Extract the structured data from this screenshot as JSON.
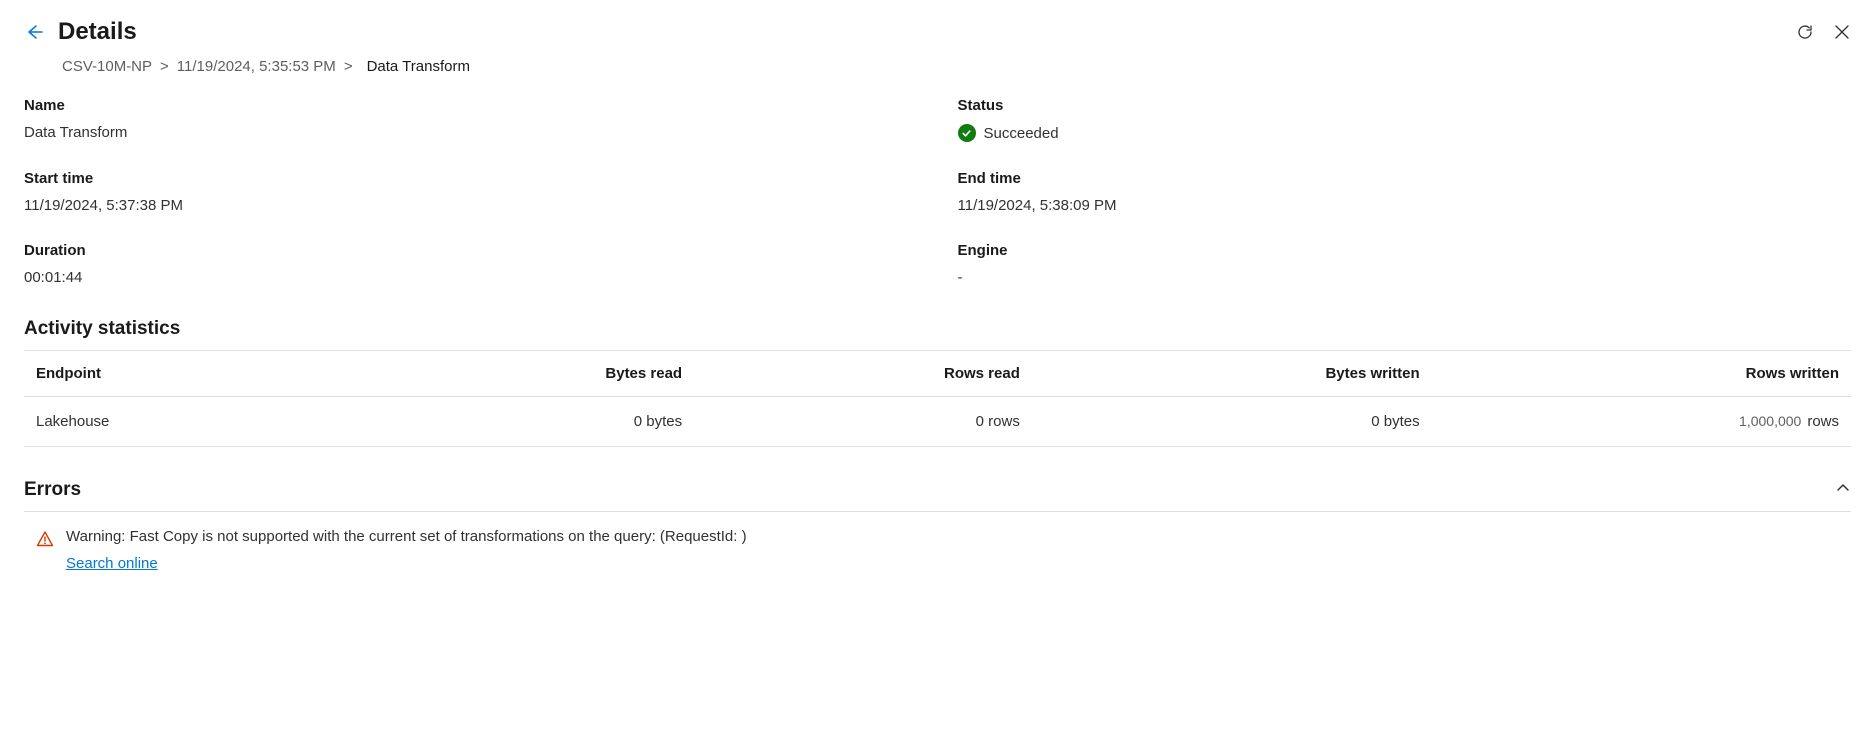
{
  "header": {
    "title": "Details"
  },
  "breadcrumb": {
    "parent": "CSV-10M-NP",
    "timestamp": "11/19/2024, 5:35:53 PM",
    "current": "Data Transform"
  },
  "fields": {
    "name_label": "Name",
    "name_value": "Data Transform",
    "status_label": "Status",
    "status_value": "Succeeded",
    "start_label": "Start time",
    "start_value": "11/19/2024, 5:37:38 PM",
    "end_label": "End time",
    "end_value": "11/19/2024, 5:38:09 PM",
    "duration_label": "Duration",
    "duration_value": "00:01:44",
    "engine_label": "Engine",
    "engine_value": "-"
  },
  "activity": {
    "title": "Activity statistics",
    "headers": {
      "endpoint": "Endpoint",
      "bytes_read": "Bytes read",
      "rows_read": "Rows read",
      "bytes_written": "Bytes written",
      "rows_written": "Rows written"
    },
    "rows": [
      {
        "endpoint": "Lakehouse",
        "bytes_read": "0 bytes",
        "rows_read": "0 rows",
        "bytes_written": "0 bytes",
        "rows_written_num": "1,000,000",
        "rows_written_unit": "rows"
      }
    ]
  },
  "errors": {
    "title": "Errors",
    "message": "Warning: Fast Copy is not supported with the current set of transformations on the query: (RequestId:   )",
    "search_link": "Search online"
  }
}
